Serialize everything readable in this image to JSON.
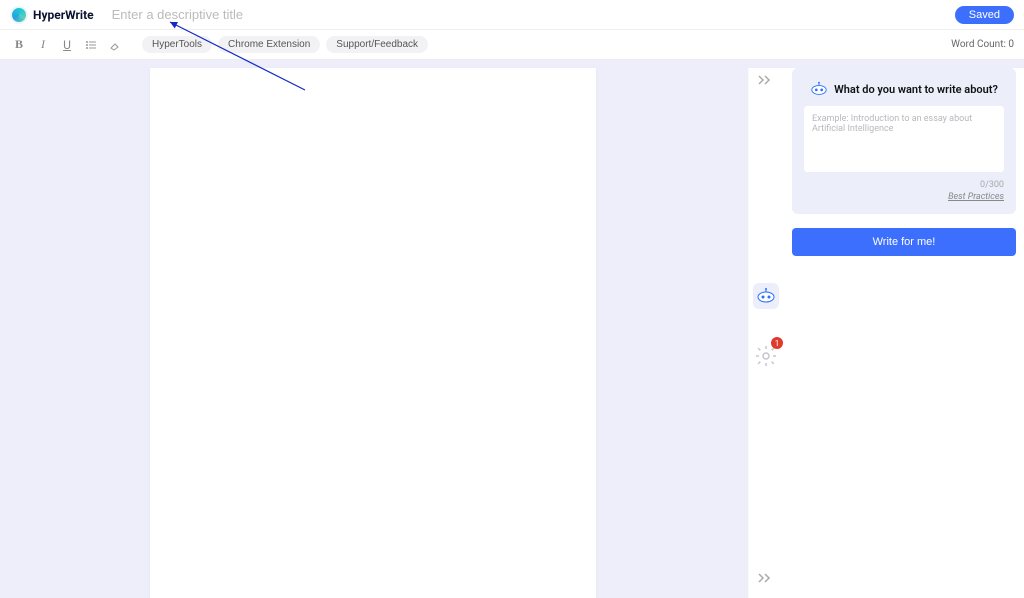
{
  "brand": {
    "name": "HyperWrite"
  },
  "header": {
    "title_placeholder": "Enter a descriptive title",
    "saved_label": "Saved"
  },
  "toolbar": {
    "hypertools_label": "HyperTools",
    "chrome_ext_label": "Chrome Extension",
    "support_label": "Support/Feedback",
    "word_count_label": "Word Count: 0"
  },
  "right": {
    "panel_title": "What do you want to write about?",
    "placeholder": "Example: Introduction to an essay about Artificial Intelligence",
    "char_counter": "0/300",
    "best_practices": "Best Practices",
    "write_label": "Write for me!"
  },
  "rail": {
    "gear_badge": "1"
  }
}
